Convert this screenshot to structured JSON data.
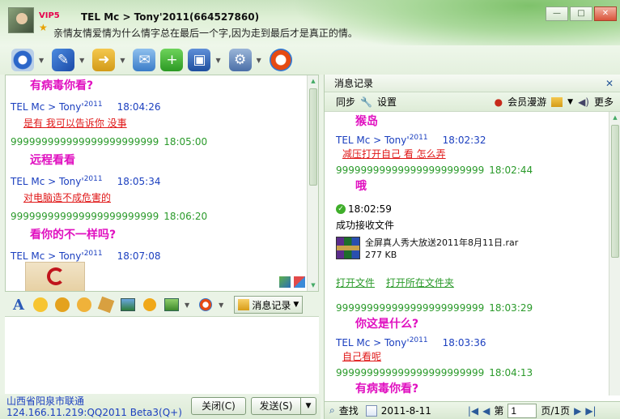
{
  "header": {
    "vip": "VIP5",
    "contact_name": "TEL Mc > Tony'2011(664527860)",
    "signature": "亲情友情爱情为什么情字总在最后一个字,因为走到最后才是真正的情。",
    "window_buttons": [
      "—",
      "□",
      "✕"
    ]
  },
  "toolbar": {
    "icons": [
      "video-icon",
      "voice-icon",
      "folder-icon",
      "mail-icon",
      "add-icon",
      "remote-icon",
      "settings-icon",
      "share-icon"
    ]
  },
  "chat": {
    "messages": [
      {
        "kind": "pink",
        "text": "有病毒你看?"
      },
      {
        "kind": "sender",
        "name": "TEL Mc > Tony'",
        "year": "2011",
        "time": "18:04:26"
      },
      {
        "kind": "red",
        "text": "是有 我可以告诉你 没事"
      },
      {
        "kind": "green",
        "text": "999999999999999999999999",
        "time": "18:05:00"
      },
      {
        "kind": "pink",
        "text": "远程看看"
      },
      {
        "kind": "sender",
        "name": "TEL Mc > Tony'",
        "year": "2011",
        "time": "18:05:34"
      },
      {
        "kind": "red",
        "text": "对电脑造不成危害的"
      },
      {
        "kind": "green",
        "text": "999999999999999999999999",
        "time": "18:06:20"
      },
      {
        "kind": "pink",
        "text": "看你的不一样吗?"
      },
      {
        "kind": "sender",
        "name": "TEL Mc > Tony'",
        "year": "2011",
        "time": "18:07:08"
      }
    ]
  },
  "input_toolbar": {
    "history_label": "消息记录"
  },
  "footer": {
    "location": "山西省阳泉市联通",
    "ip": "124.166.11.219:QQ2011 Beta3(Q+)",
    "close_label": "关闭(C)",
    "send_label": "发送(S)",
    "send_drop": "▼"
  },
  "history": {
    "title": "消息记录",
    "sync": "同步",
    "settings": "设置",
    "member": "会员漫游",
    "more": "更多",
    "messages": [
      {
        "kind": "pink",
        "text": "猴岛"
      },
      {
        "kind": "sender",
        "name": "TEL Mc > Tony'",
        "year": "2011",
        "time": "18:02:32"
      },
      {
        "kind": "red",
        "text": "减压打开自己 看 怎么弄"
      },
      {
        "kind": "green",
        "text": "999999999999999999999999",
        "time": "18:02:44"
      },
      {
        "kind": "pink",
        "text": "哦"
      }
    ],
    "file_time": "18:02:59",
    "file_status": "成功接收文件",
    "file_name": "全屏真人秀大放送2011年8月11日.rar",
    "file_size": "277 KB",
    "open_file": "打开文件",
    "open_folder": "打开所在文件夹",
    "messages2": [
      {
        "kind": "green",
        "text": "999999999999999999999999",
        "time": "18:03:29"
      },
      {
        "kind": "pink",
        "text": "你这是什么?"
      },
      {
        "kind": "sender",
        "name": "TEL Mc > Tony'",
        "year": "2011",
        "time": "18:03:36"
      },
      {
        "kind": "red",
        "text": "自己看呢"
      },
      {
        "kind": "green",
        "text": "999999999999999999999999",
        "time": "18:04:13"
      },
      {
        "kind": "pink",
        "text": "有病毒你看?"
      }
    ],
    "search": "查找",
    "date": "2011-8-11",
    "page_prefix": "第",
    "page_value": "1",
    "page_suffix": "页/1页"
  }
}
